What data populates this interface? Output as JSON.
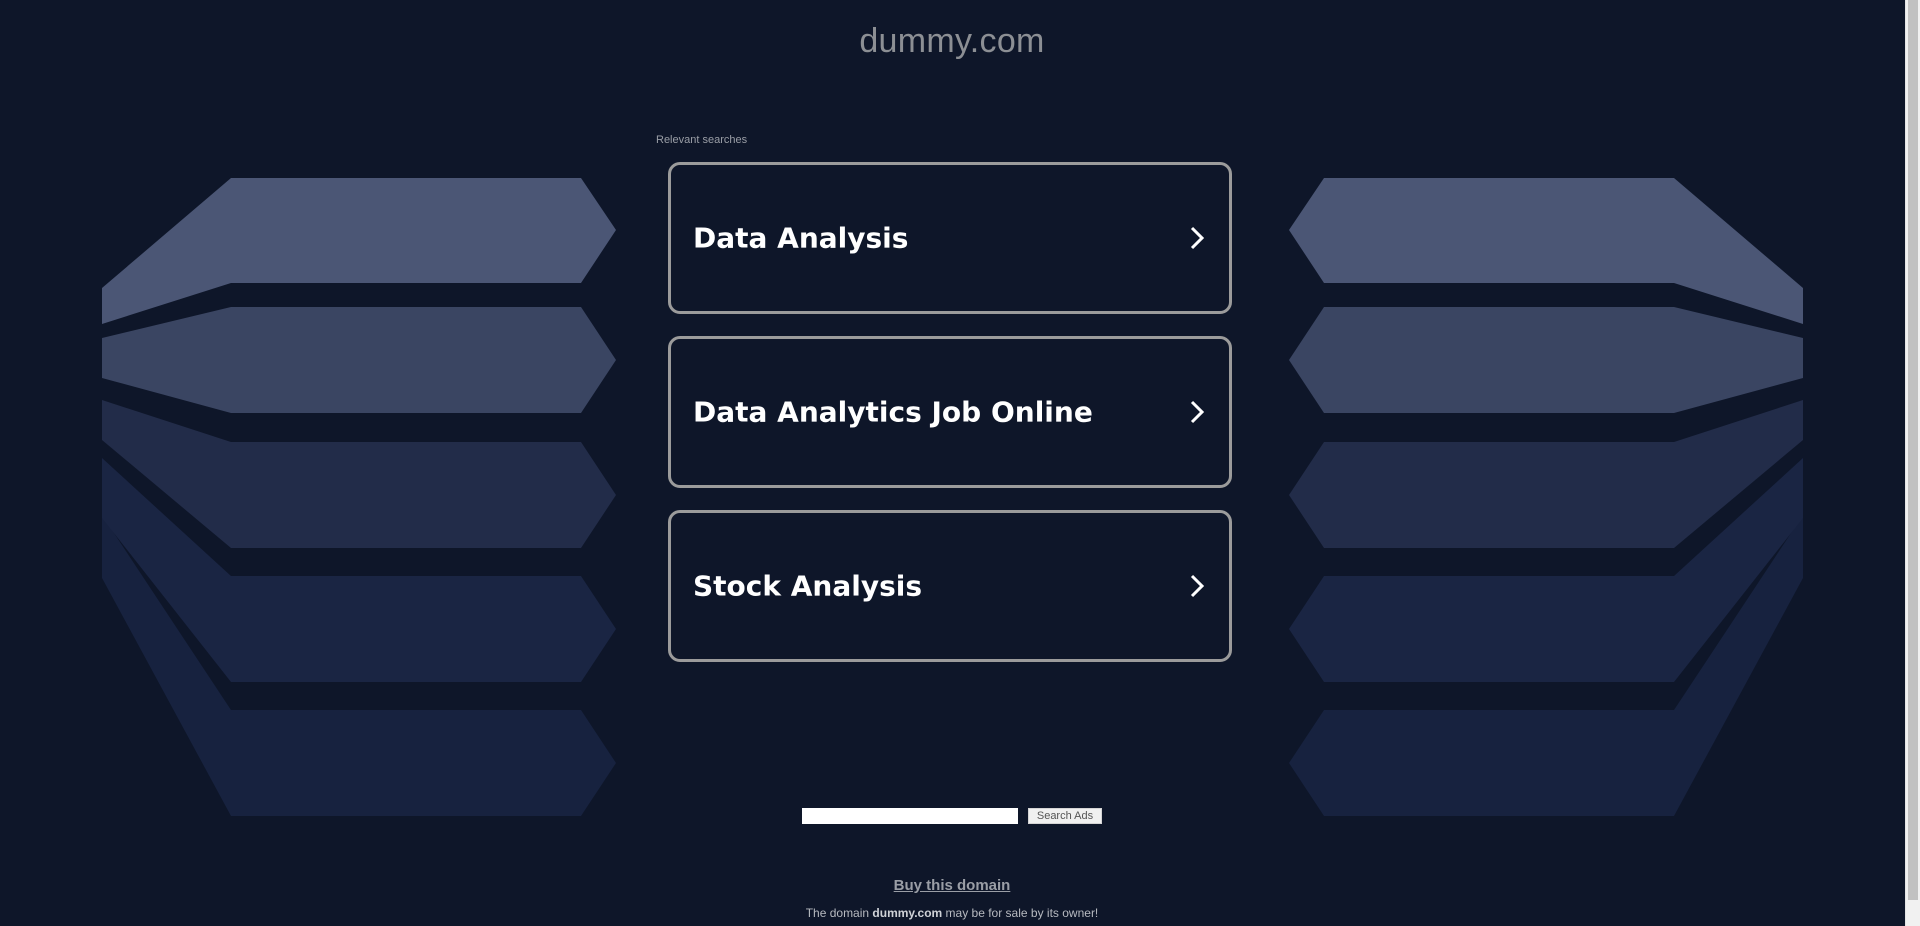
{
  "header": {
    "domain_title": "dummy.com"
  },
  "searches": {
    "label": "Relevant searches",
    "items": [
      {
        "label": "Data Analysis",
        "icon": "chevron-right-icon"
      },
      {
        "label": "Data Analytics Job Online",
        "icon": "chevron-right-icon"
      },
      {
        "label": "Stock Analysis",
        "icon": "chevron-right-icon"
      }
    ]
  },
  "search_form": {
    "input_value": "",
    "input_placeholder": "",
    "button_label": "Search Ads"
  },
  "footer": {
    "buy_link": "Buy this domain",
    "sale_prefix": "The domain ",
    "sale_domain": "dummy.com",
    "sale_suffix": " may be for sale by its owner!"
  },
  "colors": {
    "background": "#0e1629",
    "card_border": "#9b9b9b",
    "card_text": "#ffffff",
    "title_text": "#8c8f94",
    "shape_1": "#4b5675",
    "shape_2": "#3a4562",
    "shape_3": "#222c49",
    "shape_4": "#1a2543",
    "shape_5": "#17223f"
  }
}
